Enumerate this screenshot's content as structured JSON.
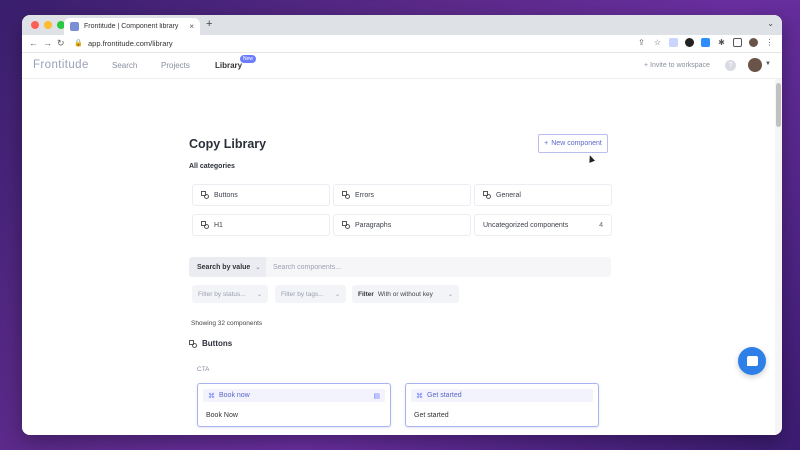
{
  "browser": {
    "tab_title": "Frontitude | Component library",
    "tab_close": "×",
    "new_tab": "+",
    "url": "app.frontitude.com/library",
    "traffic_lights": [
      "#ff5f57",
      "#febc2e",
      "#28c840"
    ]
  },
  "appbar": {
    "brand": "Frontitude",
    "nav": [
      {
        "label": "Search"
      },
      {
        "label": "Projects"
      },
      {
        "label": "Library",
        "active": true
      }
    ],
    "new_badge": "New",
    "invite": "+ Invite to workspace",
    "help": "?"
  },
  "page": {
    "title": "Copy Library",
    "new_component_label": "New component",
    "all_categories": "All categories",
    "categories": [
      {
        "label": "Buttons",
        "count": ""
      },
      {
        "label": "Errors",
        "count": ""
      },
      {
        "label": "General",
        "count": ""
      },
      {
        "label": "H1",
        "count": ""
      },
      {
        "label": "Paragraphs",
        "count": ""
      },
      {
        "label": "Uncategorized components",
        "count": "4"
      }
    ],
    "search": {
      "mode_label": "Search by value",
      "placeholder": "Search components..."
    },
    "filters": {
      "status_placeholder": "Filter by status...",
      "tags_placeholder": "Filter by tags...",
      "key_label": "Filter",
      "key_value": "With or without key"
    },
    "showing": "Showing 32 components",
    "group_title": "Buttons",
    "subgroup": "CTA",
    "cards": [
      {
        "name": "Book now",
        "text": "Book Now"
      },
      {
        "name": "Get started",
        "text": "Get started"
      }
    ]
  },
  "colors": {
    "accent": "#6b7cff",
    "chat": "#2f7fe8"
  }
}
